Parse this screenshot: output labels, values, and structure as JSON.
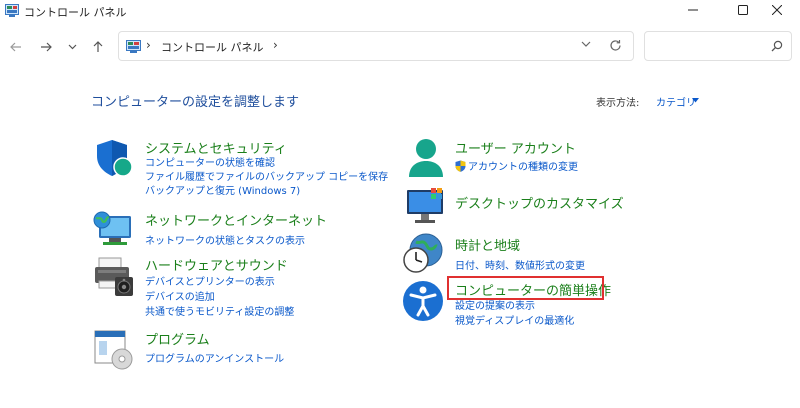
{
  "window": {
    "title": "コントロール パネル"
  },
  "address": {
    "crumb": "コントロール パネル",
    "separator": "›",
    "search_placeholder": ""
  },
  "header": {
    "page_title": "コンピューターの設定を調整します",
    "view_by_label": "表示方法:",
    "view_by_value": "カテゴリ"
  },
  "categories": [
    {
      "title": "システムとセキュリティ",
      "icon": "security-shield-icon",
      "links": [
        "コンピューターの状態を確認",
        "ファイル履歴でファイルのバックアップ コピーを保存",
        "バックアップと復元 (Windows 7)"
      ]
    },
    {
      "title": "ネットワークとインターネット",
      "icon": "network-globe-icon",
      "links": [
        "ネットワークの状態とタスクの表示"
      ]
    },
    {
      "title": "ハードウェアとサウンド",
      "icon": "printer-speaker-icon",
      "links": [
        "デバイスとプリンターの表示",
        "デバイスの追加",
        "共通で使うモビリティ設定の調整"
      ]
    },
    {
      "title": "プログラム",
      "icon": "programs-disc-icon",
      "links": [
        "プログラムのアンインストール"
      ]
    },
    {
      "title": "ユーザー アカウント",
      "icon": "user-account-icon",
      "links": [
        "アカウントの種類の変更"
      ]
    },
    {
      "title": "デスクトップのカスタマイズ",
      "icon": "desktop-monitor-icon",
      "links": []
    },
    {
      "title": "時計と地域",
      "icon": "clock-globe-icon",
      "links": [
        "日付、時刻、数値形式の変更"
      ]
    },
    {
      "title": "コンピューターの簡単操作",
      "icon": "accessibility-icon",
      "links": [
        "設定の提案の表示",
        "視覚ディスプレイの最適化"
      ]
    }
  ],
  "colors": {
    "category_title": "#1a7f1a",
    "link": "#0a58ca",
    "heading": "#1f4e9c",
    "highlight": "#e03030"
  }
}
